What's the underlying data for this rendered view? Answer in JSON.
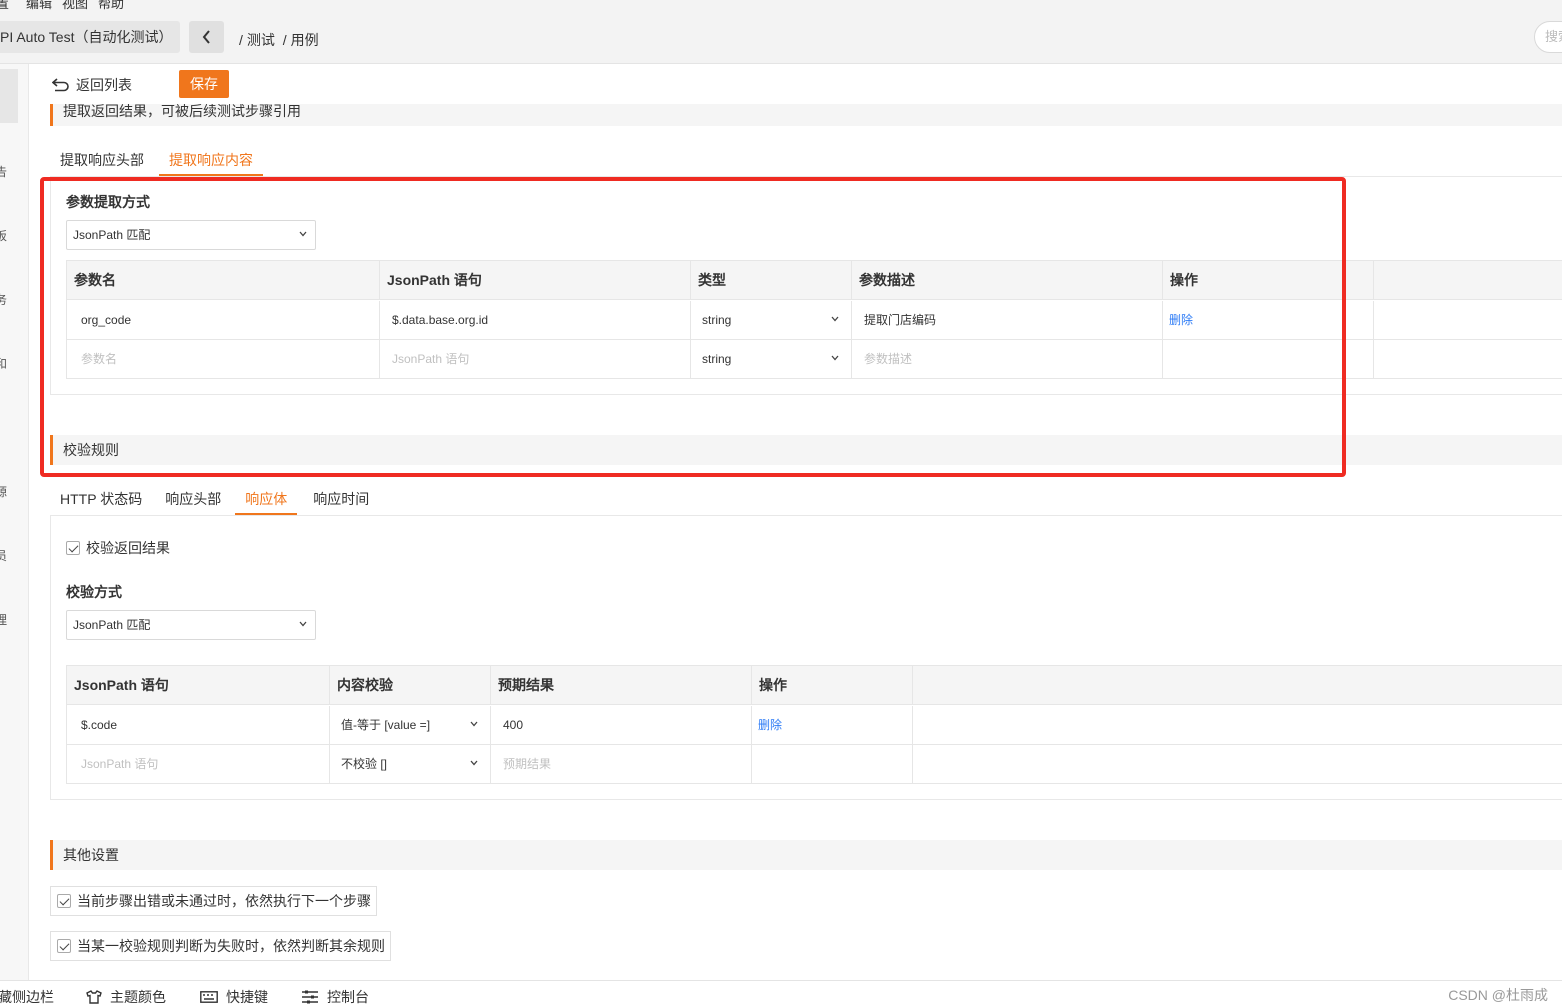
{
  "menubar": {
    "items": [
      "置",
      "编辑",
      "视图",
      "帮助"
    ]
  },
  "header": {
    "project_name": "PI Auto Test（自动化测试）",
    "breadcrumb_1": "测试",
    "breadcrumb_2": "用例",
    "search_placeholder": "搜索"
  },
  "leftnav": {
    "chars": [
      "告",
      "板",
      "务",
      "和",
      "源",
      "员",
      "理"
    ]
  },
  "toolbar": {
    "return_label": "返回列表",
    "save_label": "保存"
  },
  "extract": {
    "section_title": "提取返回结果，可被后续测试步骤引用",
    "tabs": [
      "提取响应头部",
      "提取响应内容"
    ],
    "active_tab": 1,
    "method_label": "参数提取方式",
    "method_value": "JsonPath 匹配",
    "columns": [
      "参数名",
      "JsonPath 语句",
      "类型",
      "参数描述",
      "操作"
    ],
    "row": {
      "name": "org_code",
      "path": "$.data.base.org.id",
      "type": "string",
      "desc": "提取门店编码",
      "action": "删除"
    },
    "new_row": {
      "name_ph": "参数名",
      "path_ph": "JsonPath 语句",
      "type": "string",
      "desc_ph": "参数描述"
    }
  },
  "validate": {
    "section_title": "校验规则",
    "tabs": [
      "HTTP 状态码",
      "响应头部",
      "响应体",
      "响应时间"
    ],
    "active_tab": 2,
    "checkbox_label": "校验返回结果",
    "method_label": "校验方式",
    "method_value": "JsonPath 匹配",
    "columns": [
      "JsonPath 语句",
      "内容校验",
      "预期结果",
      "操作"
    ],
    "row": {
      "path": "$.code",
      "check": "值-等于 [value =]",
      "expected": "400",
      "action": "删除"
    },
    "new_row": {
      "path_ph": "JsonPath 语句",
      "check": "不校验 []",
      "expected_ph": "预期结果"
    }
  },
  "other": {
    "section_title": "其他设置",
    "option_1": "当前步骤出错或未通过时，依然执行下一个步骤",
    "option_2": "当某一校验规则判断为失败时，依然判断其余规则"
  },
  "statusbar": {
    "sidebar": "藏侧边栏",
    "theme": "主题颜色",
    "shortcuts": "快捷键",
    "console": "控制台",
    "watermark": "CSDN @杜雨成"
  },
  "colors": {
    "accent": "#f0761c",
    "link": "#2e7cf6",
    "highlight": "#ef2b22"
  }
}
